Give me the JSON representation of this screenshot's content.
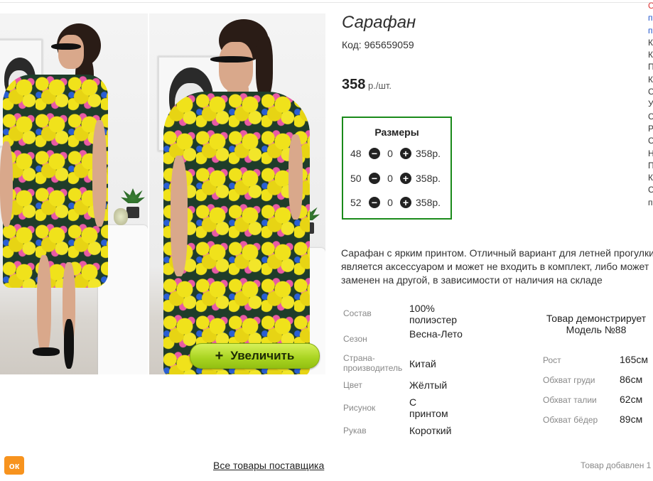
{
  "product": {
    "title": "Сарафан",
    "code": "Код: 965659059",
    "price": "358",
    "price_unit": " р./шт."
  },
  "zoom": {
    "plus": "+",
    "label": "Увеличить"
  },
  "sizes": {
    "title": "Размеры",
    "rows": [
      {
        "size": "48",
        "qty": "0",
        "price": "358р."
      },
      {
        "size": "50",
        "qty": "0",
        "price": "358р."
      },
      {
        "size": "52",
        "qty": "0",
        "price": "358р."
      }
    ],
    "minus": "−",
    "plus": "+"
  },
  "description": {
    "line1": "Сарафан с ярким принтом. Отличный вариант для летней прогулки",
    "line2": "является аксессуаром и может не входить в комплект, либо может",
    "line3": "заменен на другой, в зависимости от наличия на складе"
  },
  "attributes": [
    {
      "label": "Состав",
      "value": "100% полиэстер"
    },
    {
      "label": "Сезон",
      "value": "Весна-Лето"
    },
    {
      "label": "Страна-производитель",
      "value": "Китай"
    },
    {
      "label": "Цвет",
      "value": "Жёлтый"
    },
    {
      "label": "Рисунок",
      "value": "С принтом"
    },
    {
      "label": "Рукав",
      "value": "Короткий"
    }
  ],
  "model": {
    "title_line1": "Товар демонстрирует",
    "title_line2": "Модель №88",
    "params": [
      {
        "label": "Рост",
        "value": "165см"
      },
      {
        "label": "Обхват груди",
        "value": "86см"
      },
      {
        "label": "Обхват талии",
        "value": "62см"
      },
      {
        "label": "Обхват бёдер",
        "value": "89см"
      }
    ]
  },
  "right_column_letters": [
    "С",
    "п",
    "п",
    "К",
    "К",
    "П",
    "К",
    "С",
    "У",
    "С",
    "Р",
    "С",
    "Н",
    "П",
    "К",
    "С",
    "п"
  ],
  "footer": {
    "ok_icon": "odnoklassniki-icon",
    "ok_glyph": "ок",
    "supplier_link": "Все товары поставщика",
    "added": "Товар добавлен 1"
  },
  "colors": {
    "accent_green": "#1a8a1a",
    "zoom_button": "#a8d320",
    "ok_orange": "#f7931e"
  }
}
